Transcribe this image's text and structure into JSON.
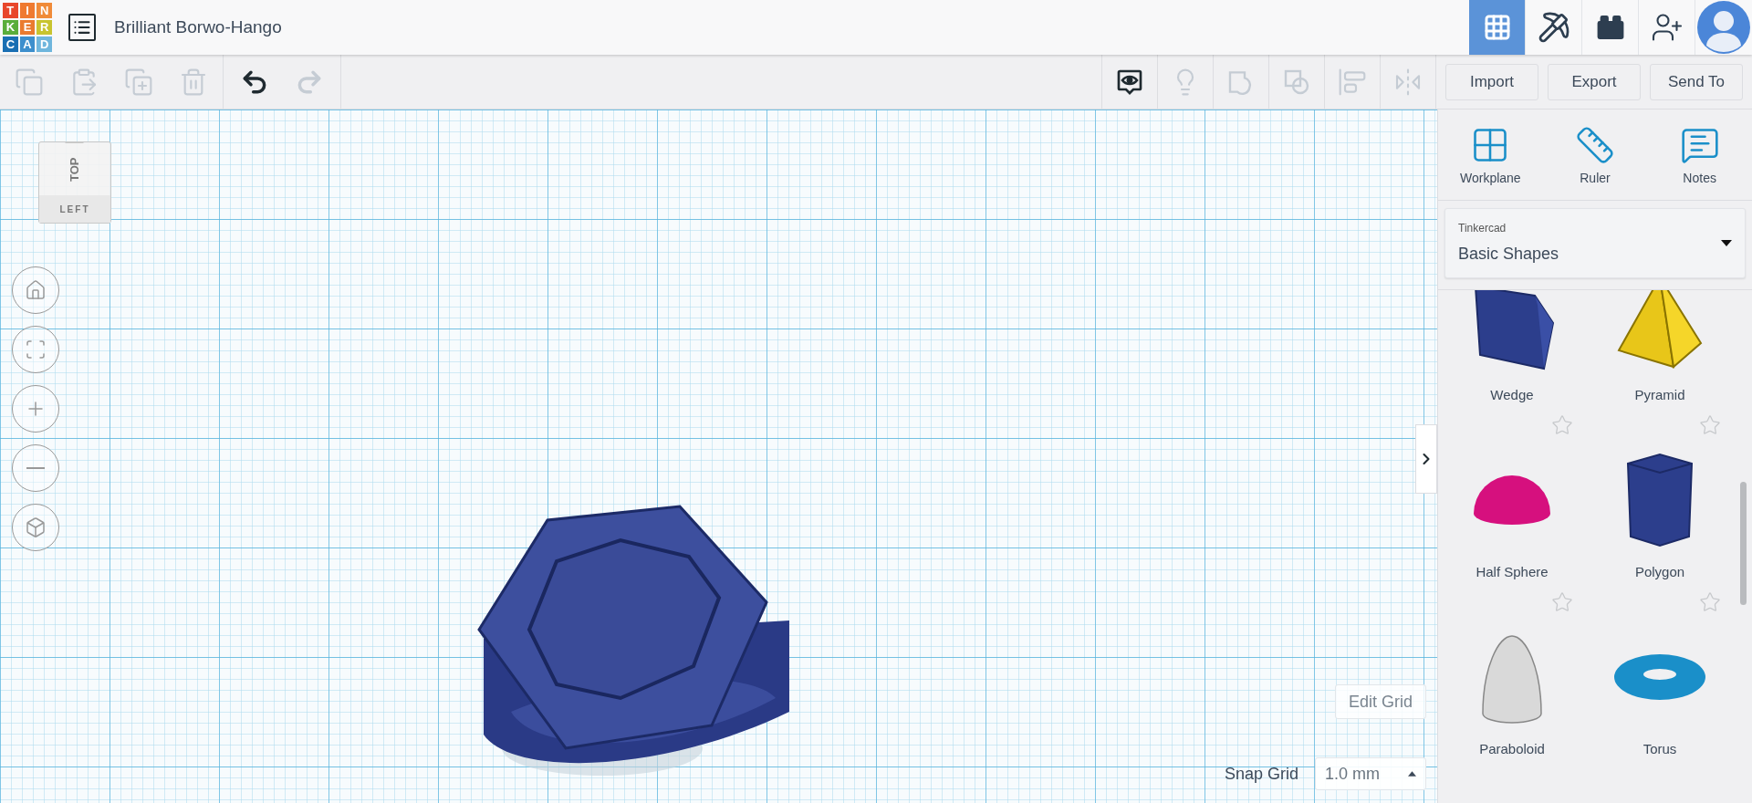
{
  "header": {
    "logo": [
      {
        "letter": "T",
        "color": "#e8462b"
      },
      {
        "letter": "I",
        "color": "#ef7a30"
      },
      {
        "letter": "N",
        "color": "#f08b39"
      },
      {
        "letter": "K",
        "color": "#5aad3b"
      },
      {
        "letter": "E",
        "color": "#ea7b2f"
      },
      {
        "letter": "R",
        "color": "#c8c42f"
      },
      {
        "letter": "C",
        "color": "#1a6fb3"
      },
      {
        "letter": "A",
        "color": "#3d8fcd"
      },
      {
        "letter": "D",
        "color": "#6fb6dd"
      }
    ],
    "title": "Brilliant Borwo-Hango",
    "modes": [
      {
        "kind": "design",
        "selected": true
      },
      {
        "kind": "pickaxe",
        "selected": false
      },
      {
        "kind": "bricks",
        "selected": false
      }
    ]
  },
  "toolbar": {
    "edit_tools": [
      {
        "kind": "copy",
        "disabled": true
      },
      {
        "kind": "paste",
        "disabled": true
      },
      {
        "kind": "duplicate",
        "disabled": true
      },
      {
        "kind": "delete",
        "disabled": true
      }
    ],
    "history": [
      {
        "kind": "undo",
        "disabled": false
      },
      {
        "kind": "redo",
        "disabled": true
      }
    ],
    "view_tools": [
      {
        "kind": "notes_visibility",
        "disabled": false
      },
      {
        "kind": "light",
        "disabled": true
      },
      {
        "kind": "group",
        "disabled": true
      },
      {
        "kind": "ungroup",
        "disabled": true
      },
      {
        "kind": "align",
        "disabled": true
      },
      {
        "kind": "mirror",
        "disabled": true
      }
    ],
    "actions": [
      "Import",
      "Export",
      "Send To"
    ]
  },
  "view_cube": {
    "top": "TOP",
    "left": "LEFT"
  },
  "nav_controls": [
    {
      "kind": "home"
    },
    {
      "kind": "fit"
    },
    {
      "kind": "zoom_in"
    },
    {
      "kind": "zoom_out"
    },
    {
      "kind": "perspective"
    }
  ],
  "workplane": {
    "edit_grid": "Edit Grid",
    "snap_label": "Snap Grid",
    "snap_value": "1.0 mm"
  },
  "sidebar": {
    "tools": [
      {
        "kind": "workplane",
        "label": "Workplane"
      },
      {
        "kind": "ruler",
        "label": "Ruler"
      },
      {
        "kind": "notes",
        "label": "Notes"
      }
    ],
    "library": {
      "source": "Tinkercad",
      "selection": "Basic Shapes"
    },
    "shapes": [
      {
        "kind": "wedge",
        "name": "Wedge",
        "color": "#2c3e8c"
      },
      {
        "kind": "pyramid",
        "name": "Pyramid",
        "color": "#e8c619"
      },
      {
        "kind": "half_sphere",
        "name": "Half Sphere",
        "color": "#d6107e",
        "starred": false
      },
      {
        "kind": "polygon",
        "name": "Polygon",
        "color": "#2c3e8c",
        "starred": false
      },
      {
        "kind": "paraboloid",
        "name": "Paraboloid",
        "color": "#d9d9d9",
        "starred": false
      },
      {
        "kind": "torus",
        "name": "Torus",
        "color": "#1a8fc9",
        "starred": false
      }
    ]
  }
}
